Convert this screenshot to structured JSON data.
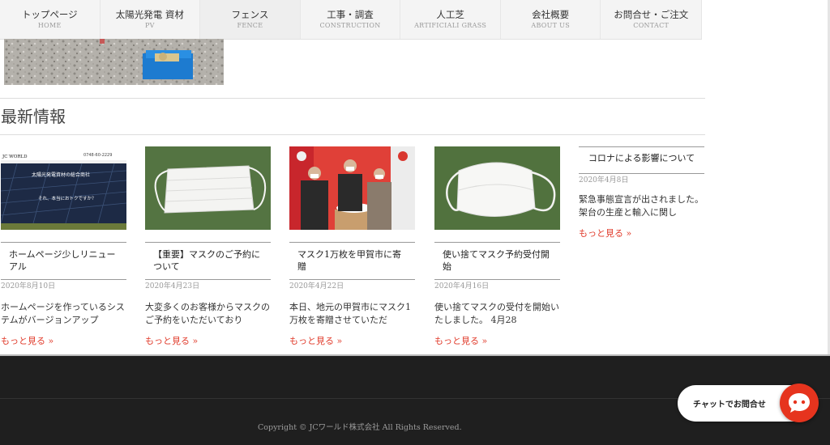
{
  "nav": [
    {
      "jp": "トップページ",
      "en": "HOME"
    },
    {
      "jp": "太陽光発電 資材",
      "en": "PV"
    },
    {
      "jp": "フェンス",
      "en": "FENCE"
    },
    {
      "jp": "工事・調査",
      "en": "CONSTRUCTION"
    },
    {
      "jp": "人工芝",
      "en": "ARTIFICIALI GRASS"
    },
    {
      "jp": "会社概要",
      "en": "ABOUT US"
    },
    {
      "jp": "お問合せ・ご注文",
      "en": "CONTACT"
    }
  ],
  "news": {
    "heading": "最新情報",
    "posts": [
      {
        "title": "ホームページ少しリニューアル",
        "date": "2020年8月10日",
        "excerpt": "ホームページを作っているシステムがバージョンアップ",
        "more": "もっと見る »"
      },
      {
        "title": "【重要】マスクのご予約について",
        "date": "2020年4月23日",
        "excerpt": "大変多くのお客様からマスクのご予約をいただいており",
        "more": "もっと見る »"
      },
      {
        "title": "マスク1万枚を甲賀市に寄贈",
        "date": "2020年4月22日",
        "excerpt": "本日、地元の甲賀市にマスク1万枚を寄贈させていただ",
        "more": "もっと見る »"
      },
      {
        "title": "使い捨てマスク予約受付開始",
        "date": "2020年4月16日",
        "excerpt": "使い捨てマスクの受付を開始いたしました。 4月28",
        "more": "もっと見る »"
      },
      {
        "title": "コロナによる影響について",
        "date": "2020年4月8日",
        "excerpt": "緊急事態宣言が出されました。架台の生産と輸入に関し",
        "more": "もっと見る »"
      }
    ]
  },
  "thumb1": {
    "site_name": "JC WORLD",
    "tagline": "太陽光発電資材の総合商社",
    "tel": "0748-60-2229",
    "q": "それ、本当におトクですか？"
  },
  "footer": {
    "copyright": "Copyright © JCワールド株式会社 All Rights Reserved."
  },
  "chat": {
    "label": "チャットでお問合せ"
  }
}
